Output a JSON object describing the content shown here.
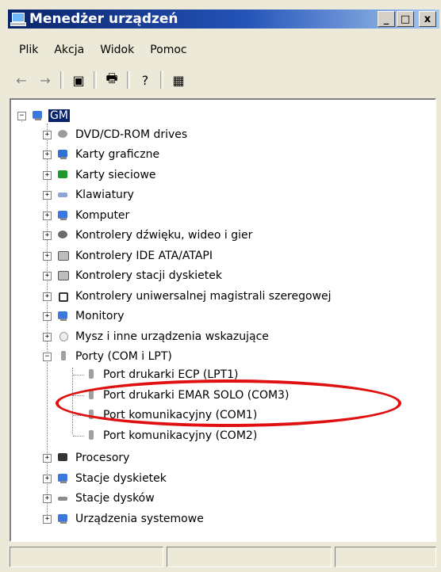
{
  "window": {
    "title": "Menedżer urządzeń",
    "buttons": {
      "minimize": "_",
      "maximize": "□",
      "close": "x"
    }
  },
  "menu": {
    "items": [
      "Plik",
      "Akcja",
      "Widok",
      "Pomoc"
    ]
  },
  "toolbar": {
    "icons": [
      "back-arrow-icon",
      "forward-arrow-icon",
      "properties-icon",
      "print-icon",
      "help-icon",
      "scan-hardware-icon"
    ],
    "glyphs": {
      "back": "←",
      "forward": "→",
      "properties": "▣",
      "print": "🖶",
      "help": "?",
      "scan": "▦"
    }
  },
  "tree": {
    "root": {
      "label": "GM",
      "icon": "computer-icon"
    },
    "categories": [
      {
        "label": "DVD/CD-ROM drives",
        "icon": "cdrom-icon",
        "color": "#9c9c9c"
      },
      {
        "label": "Karty graficzne",
        "icon": "display-adapter-icon",
        "color": "#2f6fd6"
      },
      {
        "label": "Karty sieciowe",
        "icon": "network-card-icon",
        "color": "#1e9a2c"
      },
      {
        "label": "Klawiatury",
        "icon": "keyboard-icon",
        "color": "#8aa6d6"
      },
      {
        "label": "Komputer",
        "icon": "computer-icon",
        "color": "#3a78e0"
      },
      {
        "label": "Kontrolery dźwięku, wideo i gier",
        "icon": "sound-icon",
        "color": "#6a6a6a"
      },
      {
        "label": "Kontrolery IDE ATA/ATAPI",
        "icon": "ide-controller-icon",
        "color": "#7a7a7a"
      },
      {
        "label": "Kontrolery stacji dyskietek",
        "icon": "floppy-controller-icon",
        "color": "#7a7a7a"
      },
      {
        "label": "Kontrolery uniwersalnej magistrali szeregowej",
        "icon": "usb-icon",
        "color": "#333333"
      },
      {
        "label": "Monitory",
        "icon": "monitor-icon",
        "color": "#3a78e0"
      },
      {
        "label": "Mysz i inne urządzenia wskazujące",
        "icon": "mouse-icon",
        "color": "#d0d0d0"
      },
      {
        "label": "Porty (COM i LPT)",
        "icon": "port-icon",
        "color": "#9a9a9a",
        "expanded": true,
        "children": [
          {
            "label": "Port drukarki ECP (LPT1)",
            "icon": "port-icon"
          },
          {
            "label": "Port drukarki EMAR SOLO (COM3)",
            "icon": "port-icon"
          },
          {
            "label": "Port komunikacyjny (COM1)",
            "icon": "port-icon"
          },
          {
            "label": "Port komunikacyjny (COM2)",
            "icon": "port-icon"
          }
        ]
      },
      {
        "label": "Procesory",
        "icon": "processor-icon",
        "color": "#333333"
      },
      {
        "label": "Stacje dyskietek",
        "icon": "floppy-drive-icon",
        "color": "#3a78e0"
      },
      {
        "label": "Stacje dysków",
        "icon": "disk-drive-icon",
        "color": "#8a8a8a"
      },
      {
        "label": "Urządzenia systemowe",
        "icon": "system-devices-icon",
        "color": "#3a78e0"
      }
    ],
    "expander": {
      "collapsed": "+",
      "expanded": "−"
    }
  },
  "annotation": {
    "highlight_color": "#e01010"
  }
}
